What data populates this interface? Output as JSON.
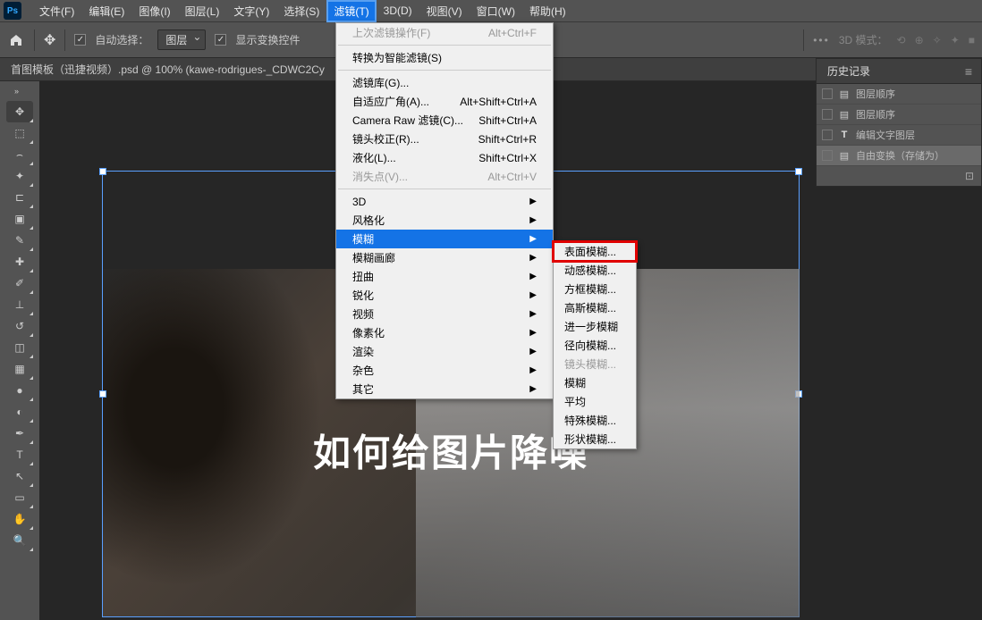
{
  "menubar": {
    "items": [
      "文件(F)",
      "编辑(E)",
      "图像(I)",
      "图层(L)",
      "文字(Y)",
      "选择(S)",
      "滤镜(T)",
      "3D(D)",
      "视图(V)",
      "窗口(W)",
      "帮助(H)"
    ],
    "activeIndex": 6
  },
  "optionsbar": {
    "autoSelect": "自动选择：",
    "layerSelect": "图层",
    "showTransform": "显示变换控件",
    "mode3d": "3D 模式："
  },
  "documentTab": "首图模板（迅捷视频）.psd @ 100% (kawe-rodrigues-_CDWC2Cy",
  "canvas": {
    "overlayText": "如何给图片降噪"
  },
  "filterMenu": {
    "items": [
      {
        "label": "上次滤镜操作(F)",
        "shortcut": "Alt+Ctrl+F",
        "disabled": true
      },
      {
        "sep": true
      },
      {
        "label": "转换为智能滤镜(S)"
      },
      {
        "sep": true
      },
      {
        "label": "滤镜库(G)..."
      },
      {
        "label": "自适应广角(A)...",
        "shortcut": "Alt+Shift+Ctrl+A"
      },
      {
        "label": "Camera Raw 滤镜(C)...",
        "shortcut": "Shift+Ctrl+A"
      },
      {
        "label": "镜头校正(R)...",
        "shortcut": "Shift+Ctrl+R"
      },
      {
        "label": "液化(L)...",
        "shortcut": "Shift+Ctrl+X"
      },
      {
        "label": "消失点(V)...",
        "shortcut": "Alt+Ctrl+V",
        "disabled": true
      },
      {
        "sep": true
      },
      {
        "label": "3D",
        "sub": true
      },
      {
        "label": "风格化",
        "sub": true
      },
      {
        "label": "模糊",
        "sub": true,
        "hl": true
      },
      {
        "label": "模糊画廊",
        "sub": true
      },
      {
        "label": "扭曲",
        "sub": true
      },
      {
        "label": "锐化",
        "sub": true
      },
      {
        "label": "视频",
        "sub": true
      },
      {
        "label": "像素化",
        "sub": true
      },
      {
        "label": "渲染",
        "sub": true
      },
      {
        "label": "杂色",
        "sub": true
      },
      {
        "label": "其它",
        "sub": true
      }
    ]
  },
  "blurSubmenu": {
    "items": [
      {
        "label": "表面模糊...",
        "boxed": true
      },
      {
        "label": "动感模糊..."
      },
      {
        "label": "方框模糊..."
      },
      {
        "label": "高斯模糊..."
      },
      {
        "label": "进一步模糊"
      },
      {
        "label": "径向模糊..."
      },
      {
        "label": "镜头模糊...",
        "disabled": true
      },
      {
        "label": "模糊"
      },
      {
        "label": "平均"
      },
      {
        "label": "特殊模糊..."
      },
      {
        "label": "形状模糊..."
      }
    ]
  },
  "historyPanel": {
    "title": "历史记录",
    "rows": [
      {
        "icon": "doc",
        "label": "图层顺序"
      },
      {
        "icon": "doc",
        "label": "图层顺序"
      },
      {
        "icon": "T",
        "label": "编辑文字图层"
      },
      {
        "icon": "doc",
        "label": "自由变换（存储为）",
        "sel": true
      }
    ]
  },
  "tools": [
    "move",
    "marquee",
    "lasso",
    "wand",
    "crop",
    "frame",
    "eyedrop",
    "heal",
    "brush",
    "stamp",
    "history",
    "eraser",
    "gradient",
    "blur",
    "dodge",
    "pen",
    "type",
    "path",
    "shape",
    "hand",
    "zoom"
  ]
}
